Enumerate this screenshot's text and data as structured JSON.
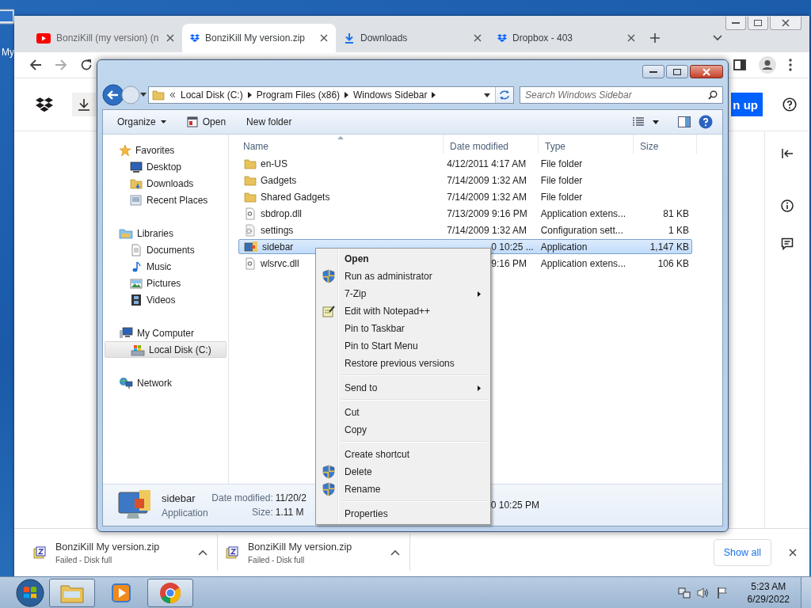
{
  "desktop": {
    "icon_label": "My"
  },
  "browser": {
    "tabs": [
      {
        "title": "BonziKill (my version) (n",
        "kind": "video",
        "selected": false
      },
      {
        "title": "BonziKill My version.zip",
        "kind": "cloud",
        "selected": true
      },
      {
        "title": "Downloads",
        "kind": "download",
        "selected": false
      },
      {
        "title": "Dropbox - 403",
        "kind": "cloud",
        "selected": false
      }
    ],
    "page": {
      "signup_button": "n up"
    },
    "downloads": [
      {
        "filename": "BonziKill My version.zip",
        "status": "Failed - Disk full"
      },
      {
        "filename": "BonziKill My version.zip",
        "status": "Failed - Disk full"
      }
    ],
    "show_all": "Show all"
  },
  "explorer": {
    "breadcrumbs": [
      "Local Disk (C:)",
      "Program Files (x86)",
      "Windows Sidebar"
    ],
    "search": {
      "placeholder": "Search Windows Sidebar"
    },
    "commands": [
      {
        "label": "Organize",
        "kind": "menu"
      },
      {
        "label": "Open",
        "kind": "icon"
      },
      {
        "label": "New folder",
        "kind": "plain"
      }
    ],
    "nav": [
      {
        "label": "Favorites",
        "kind": "favorites",
        "selected": false,
        "children": [
          {
            "label": "Desktop",
            "kind": "desktop",
            "selected": false
          },
          {
            "label": "Downloads",
            "kind": "downloads",
            "selected": false
          },
          {
            "label": "Recent Places",
            "kind": "recent",
            "selected": false
          }
        ]
      },
      {
        "label": "Libraries",
        "kind": "libraries",
        "selected": false,
        "children": [
          {
            "label": "Documents",
            "kind": "documents",
            "selected": false
          },
          {
            "label": "Music",
            "kind": "music",
            "selected": false
          },
          {
            "label": "Pictures",
            "kind": "pictures",
            "selected": false
          },
          {
            "label": "Videos",
            "kind": "videos",
            "selected": false
          }
        ]
      },
      {
        "label": "My Computer",
        "kind": "computer",
        "selected": false,
        "children": [
          {
            "label": "Local Disk (C:)",
            "kind": "disk",
            "selected": true
          }
        ]
      },
      {
        "label": "Network",
        "kind": "network",
        "selected": false
      }
    ],
    "columns": [
      "Name",
      "Date modified",
      "Type",
      "Size"
    ],
    "files": [
      {
        "name": "en-US",
        "kind": "folder",
        "date": "4/12/2011 4:17 AM",
        "type": "File folder",
        "selected": false,
        "covered": false
      },
      {
        "name": "Gadgets",
        "kind": "folder",
        "date": "7/14/2009 1:32 AM",
        "type": "File folder",
        "selected": false,
        "covered": false
      },
      {
        "name": "Shared Gadgets",
        "kind": "folder",
        "date": "7/14/2009 1:32 AM",
        "type": "File folder",
        "selected": false,
        "covered": false
      },
      {
        "name": "sbdrop.dll",
        "kind": "dll",
        "date": "7/13/2009 9:16 PM",
        "type": "Application extens...",
        "size": "81 KB",
        "selected": false,
        "covered": false
      },
      {
        "name": "settings",
        "kind": "config",
        "date": "7/14/2009 1:32 AM",
        "type": "Configuration sett...",
        "size": "1 KB",
        "selected": false,
        "covered": false
      },
      {
        "name": "sidebar",
        "kind": "app",
        "date": "0 10:25 ...",
        "type": "Application",
        "size": "1,147 KB",
        "selected": true,
        "covered": true
      },
      {
        "name": "wlsrvc.dll",
        "kind": "dll",
        "date": "9:16 PM",
        "type": "Application extens...",
        "size": "106 KB",
        "selected": false,
        "covered": true
      }
    ],
    "details": {
      "name": "sidebar",
      "type": "Application",
      "date_label": "Date modified:",
      "date_value": "11/20/2",
      "date_tail": "0 10:25 PM",
      "size_label": "Size:",
      "size_value": "1.11 M"
    },
    "context_menu": {
      "groups": [
        [
          {
            "label": "Open",
            "default": true,
            "kind": "plain",
            "submenu": false
          },
          {
            "label": "Run as administrator",
            "default": false,
            "kind": "shield",
            "submenu": false
          },
          {
            "label": "7-Zip",
            "default": false,
            "kind": "plain",
            "submenu": true
          },
          {
            "label": "Edit with Notepad++",
            "default": false,
            "kind": "notepad",
            "submenu": false
          },
          {
            "label": "Pin to Taskbar",
            "default": false,
            "kind": "plain",
            "submenu": false
          },
          {
            "label": "Pin to Start Menu",
            "default": false,
            "kind": "plain",
            "submenu": false
          },
          {
            "label": "Restore previous versions",
            "default": false,
            "kind": "plain",
            "submenu": false
          }
        ],
        [
          {
            "label": "Send to",
            "default": false,
            "kind": "plain",
            "submenu": true
          }
        ],
        [
          {
            "label": "Cut",
            "default": false,
            "kind": "plain",
            "submenu": false
          },
          {
            "label": "Copy",
            "default": false,
            "kind": "plain",
            "submenu": false
          }
        ],
        [
          {
            "label": "Create shortcut",
            "default": false,
            "kind": "plain",
            "submenu": false
          },
          {
            "label": "Delete",
            "default": false,
            "kind": "shield",
            "submenu": false
          },
          {
            "label": "Rename",
            "default": false,
            "kind": "shield",
            "submenu": false
          }
        ],
        [
          {
            "label": "Properties",
            "default": false,
            "kind": "plain",
            "submenu": false
          }
        ]
      ]
    }
  },
  "taskbar": {
    "apps": [
      {
        "kind": "folder",
        "running": true
      },
      {
        "kind": "media",
        "running": false
      },
      {
        "kind": "browser",
        "running": true
      }
    ],
    "time": "5:23 AM",
    "date": "6/29/2022"
  }
}
